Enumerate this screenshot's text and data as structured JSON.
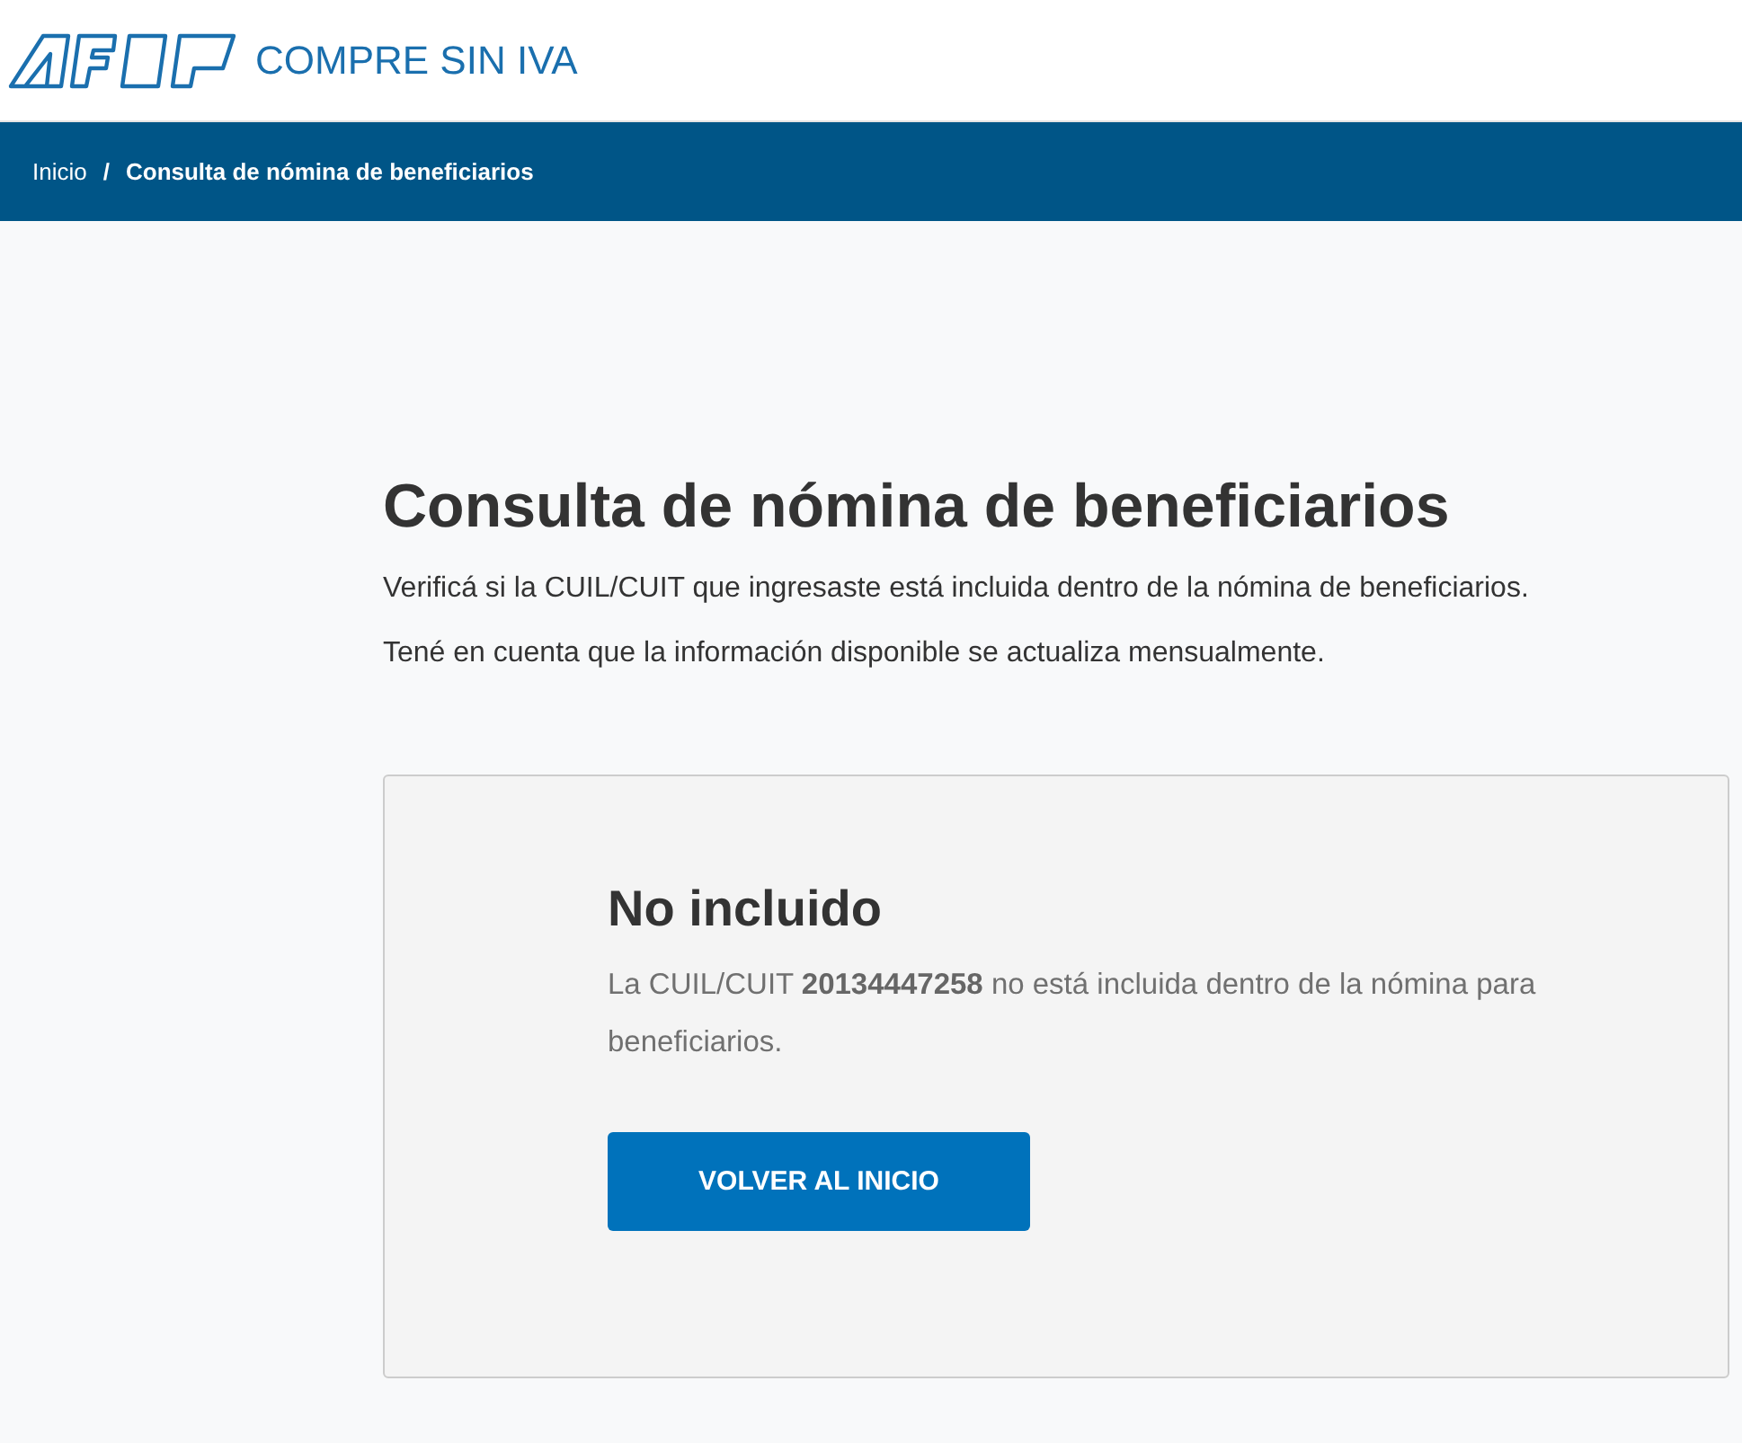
{
  "header": {
    "title": "COMPRE SIN IVA"
  },
  "breadcrumb": [
    {
      "label": "Inicio",
      "current": false
    },
    {
      "label": "Consulta de nómina de beneficiarios",
      "current": true
    }
  ],
  "breadcrumb_separator": "/",
  "page": {
    "title": "Consulta de nómina de beneficiarios",
    "paragraphs": [
      "Verificá si la CUIL/CUIT que ingresaste está incluida dentro de la nómina de beneficiarios.",
      "Tené en cuenta que la información disponible se actualiza mensualmente."
    ]
  },
  "result": {
    "title": "No incluido",
    "message": "La CUIL/CUIT **20134447258** no está incluida dentro de la nómina para beneficiarios.",
    "button": "VOLVER AL INICIO"
  }
}
